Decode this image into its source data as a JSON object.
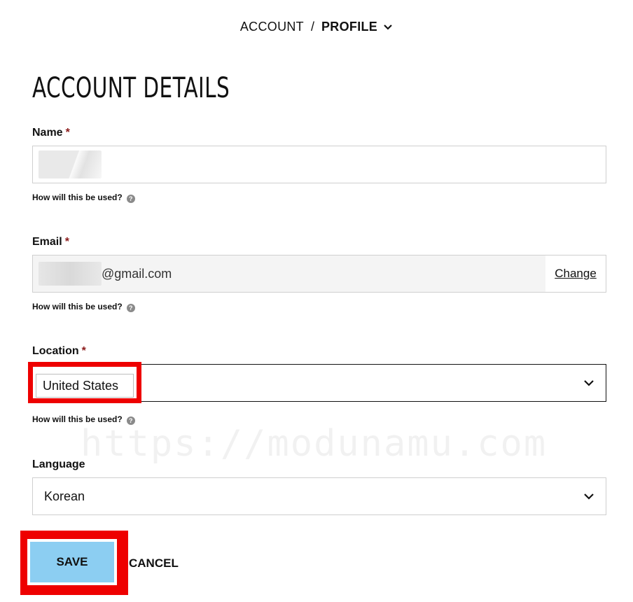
{
  "breadcrumb": {
    "account": "ACCOUNT",
    "separator": "/",
    "profile": "PROFILE"
  },
  "page_title": "ACCOUNT DETAILS",
  "required_mark": "*",
  "name_field": {
    "label": "Name",
    "value": "",
    "help": "How will this be used?"
  },
  "email_field": {
    "label": "Email",
    "value_suffix": "@gmail.com",
    "change_label": "Change",
    "help": "How will this be used?"
  },
  "location_field": {
    "label": "Location",
    "value": "United States",
    "help": "How will this be used?"
  },
  "language_field": {
    "label": "Language",
    "value": "Korean"
  },
  "help_icon": "?",
  "actions": {
    "save_label": "SAVE",
    "cancel_label": "CANCEL"
  },
  "watermark": "https://modunamu.com",
  "colors": {
    "highlight": "#ee0000",
    "save_button": "#8ccef2",
    "required": "#8b1a1a"
  }
}
